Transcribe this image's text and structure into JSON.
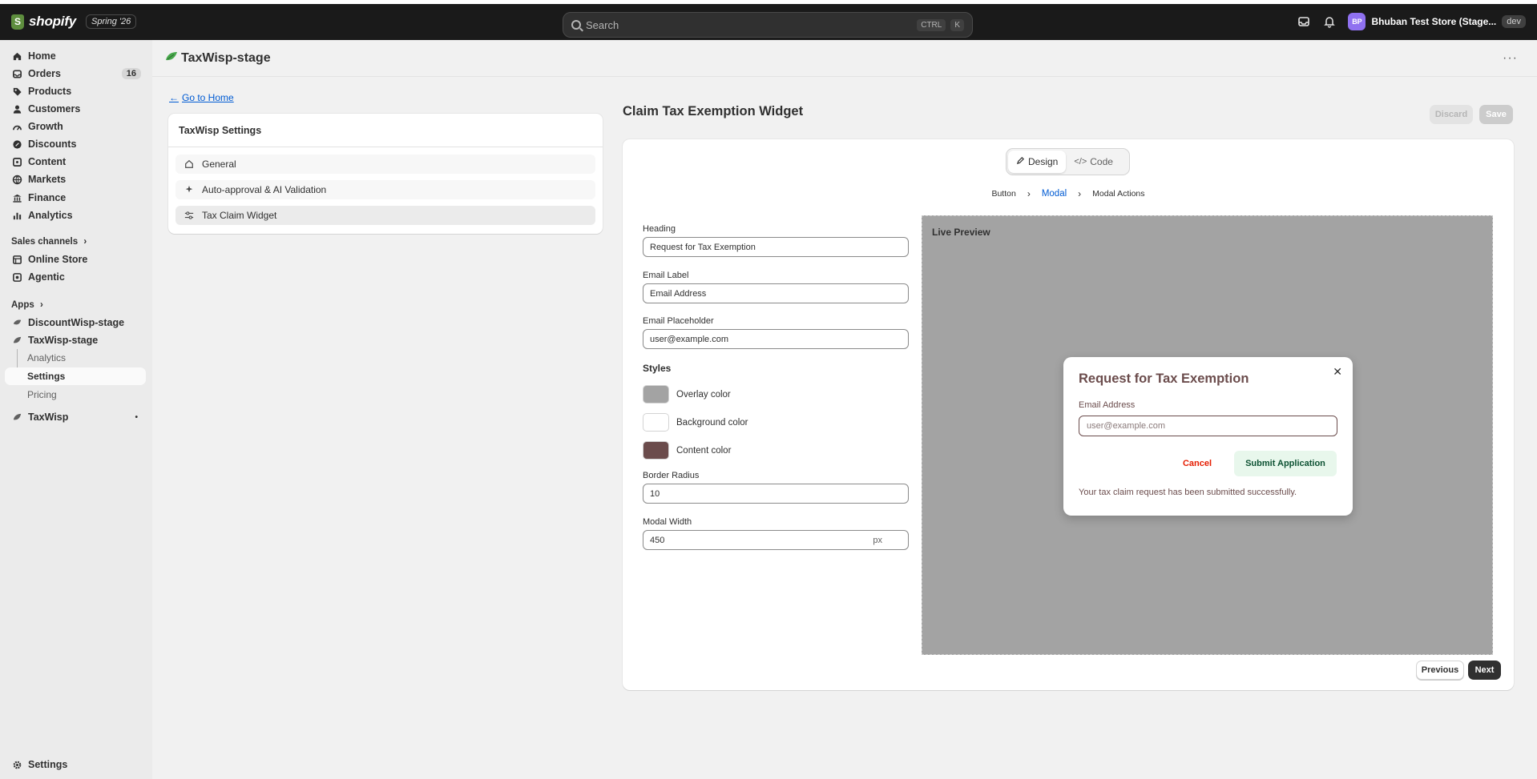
{
  "topbar": {
    "brand": "shopify",
    "badge": "Spring '26",
    "search_placeholder": "Search",
    "shortcut_keys": [
      "CTRL",
      "K"
    ],
    "store_avatar": "BP",
    "store_name": "Bhuban Test Store (Stage...",
    "store_tag": "dev"
  },
  "sidebar": {
    "items": [
      {
        "label": "Home",
        "icon": "home-icon"
      },
      {
        "label": "Orders",
        "icon": "orders-icon",
        "count": "16"
      },
      {
        "label": "Products",
        "icon": "tag-icon"
      },
      {
        "label": "Customers",
        "icon": "person-icon"
      },
      {
        "label": "Growth",
        "icon": "growth-icon"
      },
      {
        "label": "Discounts",
        "icon": "discount-icon"
      },
      {
        "label": "Content",
        "icon": "content-icon"
      },
      {
        "label": "Markets",
        "icon": "globe-icon"
      },
      {
        "label": "Finance",
        "icon": "bank-icon"
      },
      {
        "label": "Analytics",
        "icon": "chart-icon"
      }
    ],
    "sales_channels_label": "Sales channels",
    "channels": [
      {
        "label": "Online Store",
        "icon": "store-icon"
      },
      {
        "label": "Agentic",
        "icon": "agentic-icon"
      }
    ],
    "apps_label": "Apps",
    "apps": [
      {
        "label": "DiscountWisp-stage",
        "icon": "app-icon"
      },
      {
        "label": "TaxWisp-stage",
        "icon": "leaf-icon"
      }
    ],
    "app_subitems": [
      "Analytics",
      "Settings",
      "Pricing"
    ],
    "taxwisp_label": "TaxWisp",
    "settings_label": "Settings"
  },
  "app": {
    "title": "TaxWisp-stage",
    "back_link": "Go to Home",
    "settings_card": {
      "title": "TaxWisp Settings",
      "rows": [
        "General",
        "Auto-approval & AI Validation",
        "Tax Claim Widget"
      ]
    },
    "widget": {
      "title": "Claim Tax Exemption Widget",
      "discard": "Discard",
      "save": "Save",
      "tabs": [
        "Design",
        "Code"
      ],
      "crumbs": [
        "Button",
        "Modal",
        "Modal Actions"
      ],
      "form": {
        "heading_label": "Heading",
        "heading_value": "Request for Tax Exemption",
        "email_label_label": "Email Label",
        "email_label_value": "Email Address",
        "email_placeholder_label": "Email Placeholder",
        "email_placeholder_value": "user@example.com",
        "styles_title": "Styles",
        "overlay_color_label": "Overlay color",
        "background_color_label": "Background color",
        "content_color_label": "Content color",
        "border_radius_label": "Border Radius",
        "border_radius_value": "10",
        "modal_width_label": "Modal Width",
        "modal_width_value": "450",
        "modal_width_unit": "px"
      },
      "colors": {
        "overlay": "#a3a3a3",
        "background": "#ffffff",
        "content": "#6b4c4c"
      },
      "preview": {
        "title": "Live Preview",
        "modal_heading": "Request for Tax Exemption",
        "email_label": "Email Address",
        "email_placeholder": "user@example.com",
        "cancel": "Cancel",
        "submit": "Submit Application",
        "success": "Your tax claim request has been submitted successfully."
      },
      "previous": "Previous",
      "next": "Next"
    }
  }
}
